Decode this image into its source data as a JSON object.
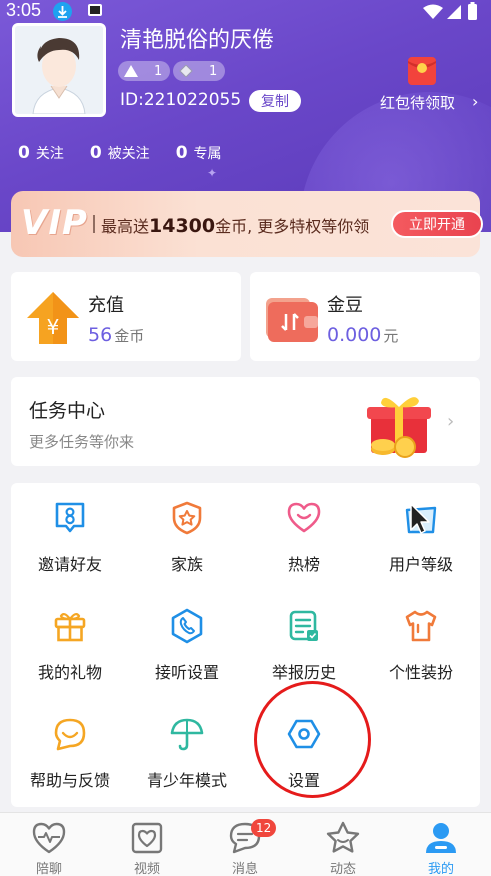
{
  "status_bar": {
    "time": "3:05"
  },
  "profile": {
    "nickname": "清艳脱俗的厌倦",
    "level_badges": [
      {
        "value": "1"
      },
      {
        "value": "1"
      }
    ],
    "id_text": "ID:221022055",
    "copy_label": "复制",
    "red_packet_label": "红包待领取",
    "stats": [
      {
        "count": "0",
        "label": "关注"
      },
      {
        "count": "0",
        "label": "被关注"
      },
      {
        "count": "0",
        "label": "专属"
      }
    ]
  },
  "vip_banner": {
    "logo": "VIP",
    "text_prefix": "最高送",
    "highlight": "14300",
    "text_suffix": "金币, 更多特权等你领",
    "button_label": "立即开通"
  },
  "wallet": {
    "recharge": {
      "title": "充值",
      "value": "56",
      "unit": "金币"
    },
    "beans": {
      "title": "金豆",
      "value": "0.000",
      "unit": "元"
    }
  },
  "task_center": {
    "title": "任务中心",
    "subtitle": "更多任务等你来"
  },
  "features": [
    {
      "label": "邀请好友",
      "icon": "invite-icon"
    },
    {
      "label": "家族",
      "icon": "family-icon"
    },
    {
      "label": "热榜",
      "icon": "hot-list-icon"
    },
    {
      "label": "用户等级",
      "icon": "user-level-icon"
    },
    {
      "label": "我的礼物",
      "icon": "gift-box-icon"
    },
    {
      "label": "接听设置",
      "icon": "phone-icon"
    },
    {
      "label": "举报历史",
      "icon": "report-icon"
    },
    {
      "label": "个性装扮",
      "icon": "tshirt-icon"
    },
    {
      "label": "帮助与反馈",
      "icon": "help-icon"
    },
    {
      "label": "青少年模式",
      "icon": "umbrella-icon"
    },
    {
      "label": "设置",
      "icon": "settings-icon"
    }
  ],
  "bottom_nav": [
    {
      "label": "陪聊",
      "icon": "heartbeat-icon"
    },
    {
      "label": "视频",
      "icon": "video-heart-icon"
    },
    {
      "label": "消息",
      "icon": "message-icon",
      "badge": "12"
    },
    {
      "label": "动态",
      "icon": "star-icon"
    },
    {
      "label": "我的",
      "icon": "me-icon",
      "active": true
    }
  ],
  "colors": {
    "header_purple": "#6a47c9",
    "accent_purple": "#6d5fe0",
    "vip_button_red": "#e9434f",
    "active_tab_blue": "#2b9af3",
    "annotation_red": "#e51b1b",
    "icon_blue": "#1f8fe6",
    "icon_orange": "#f07a3a",
    "icon_pink": "#ef5b8a",
    "icon_yellow": "#f5a623",
    "icon_teal": "#2fb8a0"
  }
}
